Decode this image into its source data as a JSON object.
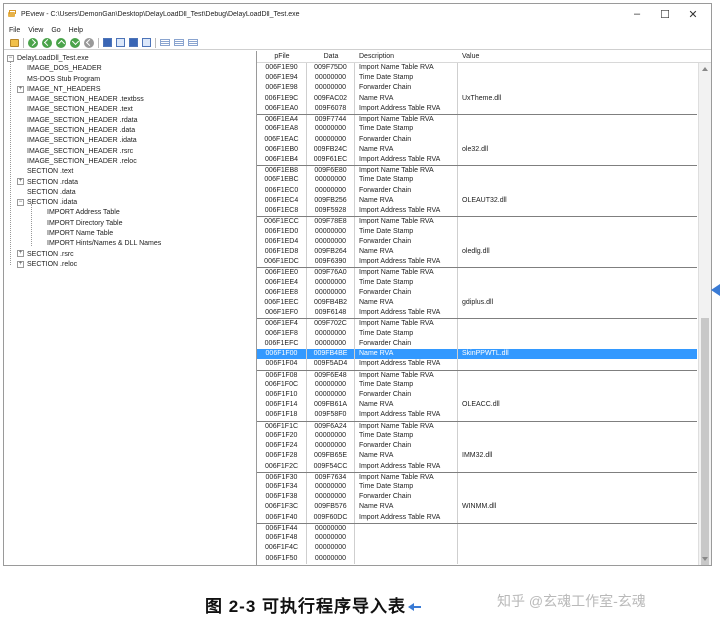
{
  "window": {
    "title": "PEview - C:\\Users\\DemonGan\\Desktop\\DelayLoadDll_Test\\Debug\\DelayLoadDll_Test.exe",
    "controls": {
      "minimize": "–",
      "maximize": "☐",
      "close": "✕"
    }
  },
  "menu": [
    "File",
    "View",
    "Go",
    "Help"
  ],
  "tree": [
    {
      "label": "DelayLoadDll_Test.exe",
      "level": 0,
      "exp": "−"
    },
    {
      "label": "IMAGE_DOS_HEADER",
      "level": 1
    },
    {
      "label": "MS-DOS Stub Program",
      "level": 1
    },
    {
      "label": "IMAGE_NT_HEADERS",
      "level": 1,
      "exp": "+"
    },
    {
      "label": "IMAGE_SECTION_HEADER .textbss",
      "level": 1
    },
    {
      "label": "IMAGE_SECTION_HEADER .text",
      "level": 1
    },
    {
      "label": "IMAGE_SECTION_HEADER .rdata",
      "level": 1
    },
    {
      "label": "IMAGE_SECTION_HEADER .data",
      "level": 1
    },
    {
      "label": "IMAGE_SECTION_HEADER .idata",
      "level": 1
    },
    {
      "label": "IMAGE_SECTION_HEADER .rsrc",
      "level": 1
    },
    {
      "label": "IMAGE_SECTION_HEADER .reloc",
      "level": 1
    },
    {
      "label": "SECTION .text",
      "level": 1
    },
    {
      "label": "SECTION .rdata",
      "level": 1,
      "exp": "+"
    },
    {
      "label": "SECTION .data",
      "level": 1
    },
    {
      "label": "SECTION .idata",
      "level": 1,
      "exp": "−"
    },
    {
      "label": "IMPORT Address Table",
      "level": 2
    },
    {
      "label": "IMPORT Directory Table",
      "level": 2
    },
    {
      "label": "IMPORT Name Table",
      "level": 2
    },
    {
      "label": "IMPORT Hints/Names & DLL Names",
      "level": 2
    },
    {
      "label": "SECTION .rsrc",
      "level": 1,
      "exp": "+"
    },
    {
      "label": "SECTION .reloc",
      "level": 1,
      "exp": "+"
    }
  ],
  "columns": [
    "pFile",
    "Data",
    "Description",
    "Value"
  ],
  "rows": [
    [
      "006F1E90",
      "009F75D0",
      "Import Name Table RVA",
      ""
    ],
    [
      "006F1E94",
      "00000000",
      "Time Date Stamp",
      ""
    ],
    [
      "006F1E98",
      "00000000",
      "Forwarder Chain",
      ""
    ],
    [
      "006F1E9C",
      "009FAC02",
      "Name RVA",
      "UxTheme.dll"
    ],
    [
      "006F1EA0",
      "009F6078",
      "Import Address Table RVA",
      ""
    ],
    [
      "006F1EA4",
      "009F7744",
      "Import Name Table RVA",
      ""
    ],
    [
      "006F1EA8",
      "00000000",
      "Time Date Stamp",
      ""
    ],
    [
      "006F1EAC",
      "00000000",
      "Forwarder Chain",
      ""
    ],
    [
      "006F1EB0",
      "009FB24C",
      "Name RVA",
      "ole32.dll"
    ],
    [
      "006F1EB4",
      "009F61EC",
      "Import Address Table RVA",
      ""
    ],
    [
      "006F1EB8",
      "009F6E80",
      "Import Name Table RVA",
      ""
    ],
    [
      "006F1EBC",
      "00000000",
      "Time Date Stamp",
      ""
    ],
    [
      "006F1EC0",
      "00000000",
      "Forwarder Chain",
      ""
    ],
    [
      "006F1EC4",
      "009FB256",
      "Name RVA",
      "OLEAUT32.dll"
    ],
    [
      "006F1EC8",
      "009F5928",
      "Import Address Table RVA",
      ""
    ],
    [
      "006F1ECC",
      "009F78E8",
      "Import Name Table RVA",
      ""
    ],
    [
      "006F1ED0",
      "00000000",
      "Time Date Stamp",
      ""
    ],
    [
      "006F1ED4",
      "00000000",
      "Forwarder Chain",
      ""
    ],
    [
      "006F1ED8",
      "009FB264",
      "Name RVA",
      "oledlg.dll"
    ],
    [
      "006F1EDC",
      "009F6390",
      "Import Address Table RVA",
      ""
    ],
    [
      "006F1EE0",
      "009F76A0",
      "Import Name Table RVA",
      ""
    ],
    [
      "006F1EE4",
      "00000000",
      "Time Date Stamp",
      ""
    ],
    [
      "006F1EE8",
      "00000000",
      "Forwarder Chain",
      ""
    ],
    [
      "006F1EEC",
      "009FB4B2",
      "Name RVA",
      "gdiplus.dll"
    ],
    [
      "006F1EF0",
      "009F6148",
      "Import Address Table RVA",
      ""
    ],
    [
      "006F1EF4",
      "009F702C",
      "Import Name Table RVA",
      ""
    ],
    [
      "006F1EF8",
      "00000000",
      "Time Date Stamp",
      ""
    ],
    [
      "006F1EFC",
      "00000000",
      "Forwarder Chain",
      ""
    ],
    [
      "006F1F00",
      "009FB4BE",
      "Name RVA",
      "SkinPPWTL.dll"
    ],
    [
      "006F1F04",
      "009F5AD4",
      "Import Address Table RVA",
      ""
    ],
    [
      "006F1F08",
      "009F6E48",
      "Import Name Table RVA",
      ""
    ],
    [
      "006F1F0C",
      "00000000",
      "Time Date Stamp",
      ""
    ],
    [
      "006F1F10",
      "00000000",
      "Forwarder Chain",
      ""
    ],
    [
      "006F1F14",
      "009FB61A",
      "Name RVA",
      "OLEACC.dll"
    ],
    [
      "006F1F18",
      "009F58F0",
      "Import Address Table RVA",
      ""
    ],
    [
      "006F1F1C",
      "009F6A24",
      "Import Name Table RVA",
      ""
    ],
    [
      "006F1F20",
      "00000000",
      "Time Date Stamp",
      ""
    ],
    [
      "006F1F24",
      "00000000",
      "Forwarder Chain",
      ""
    ],
    [
      "006F1F28",
      "009FB65E",
      "Name RVA",
      "IMM32.dll"
    ],
    [
      "006F1F2C",
      "009F54CC",
      "Import Address Table RVA",
      ""
    ],
    [
      "006F1F30",
      "009F7634",
      "Import Name Table RVA",
      ""
    ],
    [
      "006F1F34",
      "00000000",
      "Time Date Stamp",
      ""
    ],
    [
      "006F1F38",
      "00000000",
      "Forwarder Chain",
      ""
    ],
    [
      "006F1F3C",
      "009FB576",
      "Name RVA",
      "WINMM.dll"
    ],
    [
      "006F1F40",
      "009F60DC",
      "Import Address Table RVA",
      ""
    ],
    [
      "006F1F44",
      "00000000",
      "",
      ""
    ],
    [
      "006F1F48",
      "00000000",
      "",
      ""
    ],
    [
      "006F1F4C",
      "00000000",
      "",
      ""
    ],
    [
      "006F1F50",
      "00000000",
      "",
      ""
    ]
  ],
  "selected_row": 28,
  "caption": "图 2-3   可执行程序导入表",
  "watermark": "知乎 @玄魂工作室-玄魂",
  "colors": {
    "selection": "#3399ff",
    "accent": "#3a7bd5"
  }
}
